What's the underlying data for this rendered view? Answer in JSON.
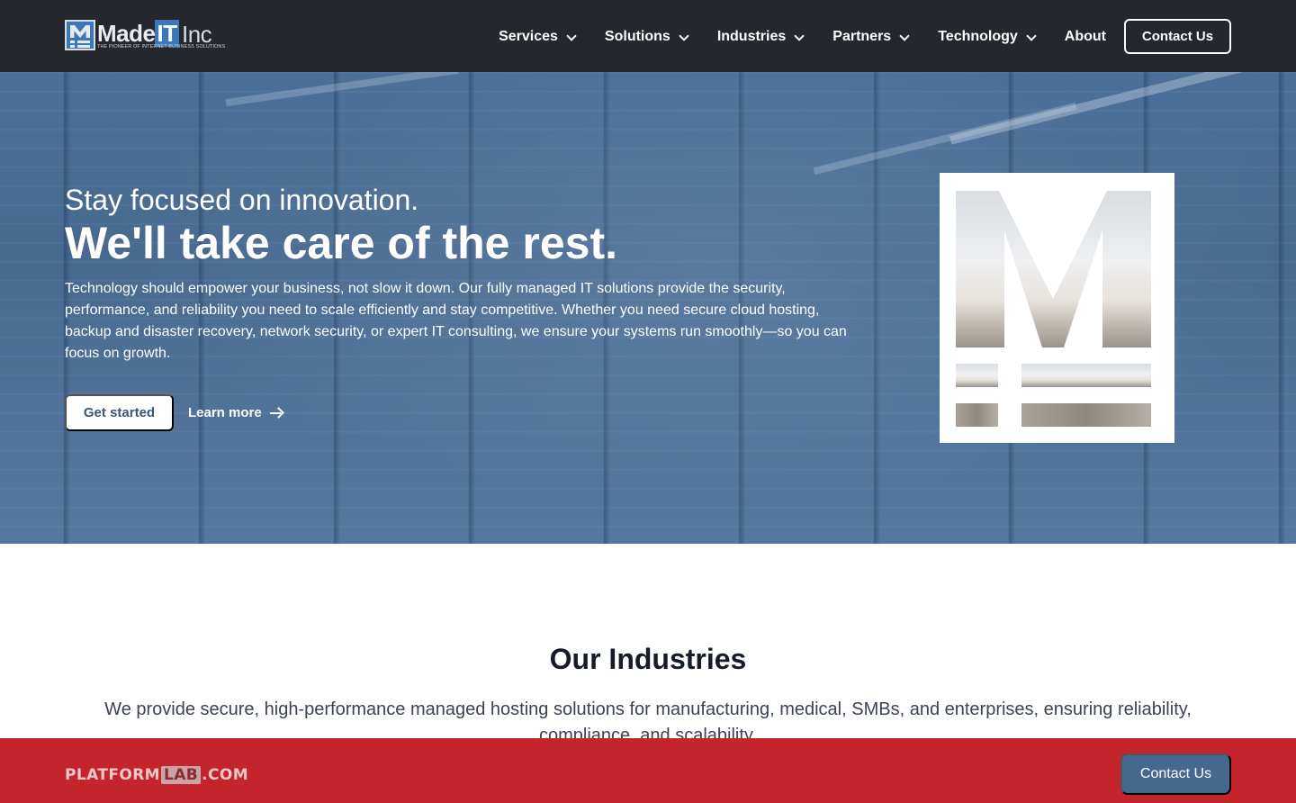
{
  "header": {
    "logo": {
      "main": "Made",
      "highlight": "IT",
      "suffix": "Inc",
      "tagline": "THE PIONEER OF INTERNET BUSINESS SOLUTIONS"
    },
    "nav": [
      {
        "label": "Services",
        "has_dropdown": true
      },
      {
        "label": "Solutions",
        "has_dropdown": true
      },
      {
        "label": "Industries",
        "has_dropdown": true
      },
      {
        "label": "Partners",
        "has_dropdown": true
      },
      {
        "label": "Technology",
        "has_dropdown": true
      },
      {
        "label": "About",
        "has_dropdown": false
      }
    ],
    "contact_label": "Contact Us"
  },
  "hero": {
    "subtitle": "Stay focused on innovation.",
    "title": "We'll take care of the rest.",
    "body": "Technology should empower your business, not slow it down. Our fully managed IT solutions provide the security, performance, and reliability you need to scale efficiently and stay competitive. Whether you need secure cloud hosting, backup and disaster recovery, network security, or expert IT consulting, we ensure your systems run smoothly—so you can focus on growth.",
    "primary_button": "Get started",
    "secondary_link": "Learn more",
    "background_color": "#4b6f99"
  },
  "industries": {
    "title": "Our Industries",
    "body": "We provide secure, high-performance managed hosting solutions for manufacturing, medical, SMBs, and enterprises, ensuring reliability, compliance, and scalability."
  },
  "promo_bar": {
    "logo_pre": "PLATFORM",
    "logo_mid": "LAB",
    "logo_post": ".COM",
    "button_label": "Contact Us",
    "background_color": "#c4242b",
    "button_color": "#46688f"
  }
}
